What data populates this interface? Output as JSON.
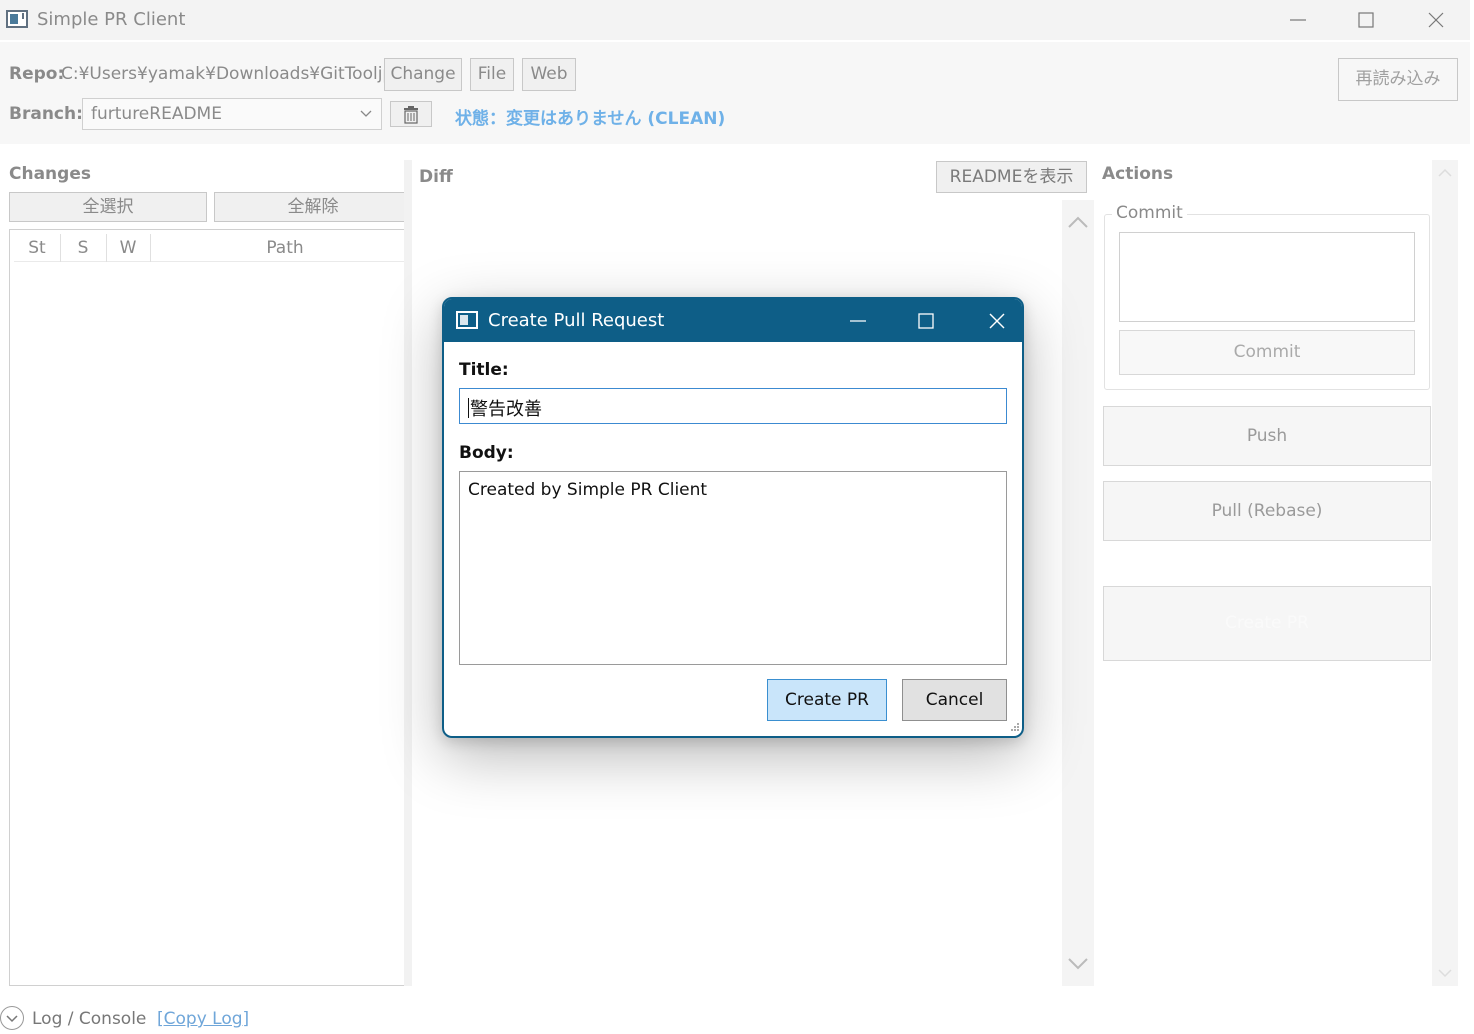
{
  "window": {
    "title": "Simple PR Client"
  },
  "topbar": {
    "repo_label": "Repo:",
    "repo_path": "C:¥Users¥yamak¥Downloads¥GitTooljp",
    "change_button": "Change",
    "file_button": "File",
    "web_button": "Web",
    "reload_button": "再読み込み",
    "branch_label": "Branch:",
    "branch_selected": "furtureREADME",
    "status_text": "状態：変更はありません (CLEAN)"
  },
  "changes": {
    "header": "Changes",
    "select_all": "全選択",
    "deselect_all": "全解除",
    "columns": [
      "St",
      "S",
      "W",
      "Path"
    ]
  },
  "diff": {
    "header": "Diff",
    "readme_button": "READMEを表示"
  },
  "actions": {
    "header": "Actions",
    "commit_group": "Commit",
    "commit_button": "Commit",
    "push_button": "Push",
    "pull_button": "Pull (Rebase)",
    "create_pr_button": "Create PR"
  },
  "log": {
    "label": "Log / Console",
    "copy_link": "[Copy Log]"
  },
  "dialog": {
    "title": "Create Pull Request",
    "title_label": "Title:",
    "title_value": "警告改善",
    "body_label": "Body:",
    "body_value": "Created by Simple PR Client",
    "create_button": "Create PR",
    "cancel_button": "Cancel"
  },
  "colors": {
    "dialog_accent": "#0e5e87",
    "status_blue": "#6fb1e8",
    "primary_button": "#c9e5fa"
  }
}
